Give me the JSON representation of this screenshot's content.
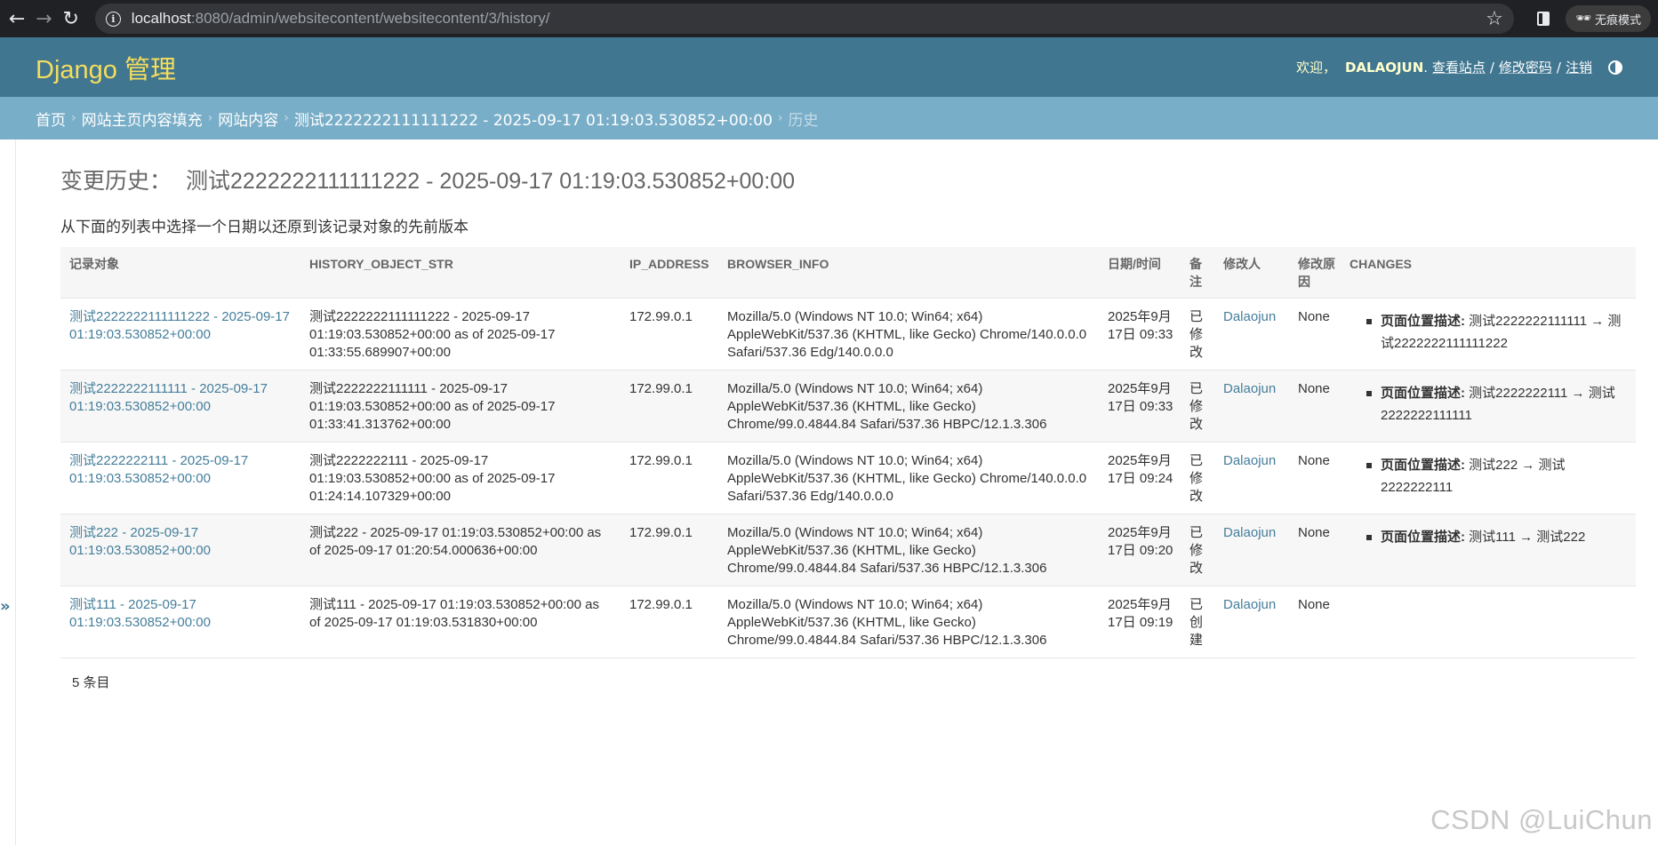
{
  "browser": {
    "url_host": "localhost",
    "url_rest": ":8080/admin/websitecontent/websitecontent/3/history/",
    "incognito_label": "无痕模式"
  },
  "header": {
    "brand": "Django 管理",
    "welcome": "欢迎，",
    "username": "DALAOJUN",
    "view_site": "查看站点",
    "change_password": "修改密码",
    "logout": "注销",
    "separator": "/"
  },
  "breadcrumbs": {
    "home": "首页",
    "app": "网站主页内容填充",
    "model": "网站内容",
    "object": "测试2222222111111222 - 2025-09-17 01:19:03.530852+00:00",
    "current": "历史"
  },
  "page": {
    "title_prefix": "变更历史：",
    "title_object": "测试2222222111111222 - 2025-09-17 01:19:03.530852+00:00",
    "instructions": "从下面的列表中选择一个日期以还原到该记录对象的先前版本",
    "paginator": "5 条目"
  },
  "table": {
    "headers": {
      "object": "记录对象",
      "history_str": "HISTORY_OBJECT_STR",
      "ip": "IP_ADDRESS",
      "browser": "BROWSER_INFO",
      "date": "日期/时间",
      "note": "备注",
      "user": "修改人",
      "reason": "修改原因",
      "changes": "CHANGES"
    },
    "rows": [
      {
        "object": "测试2222222111111222 - 2025-09-17 01:19:03.530852+00:00",
        "history_str": "测试2222222111111222 - 2025-09-17 01:19:03.530852+00:00 as of 2025-09-17 01:33:55.689907+00:00",
        "ip": "172.99.0.1",
        "browser": "Mozilla/5.0 (Windows NT 10.0; Win64; x64) AppleWebKit/537.36 (KHTML, like Gecko) Chrome/140.0.0.0 Safari/537.36 Edg/140.0.0.0",
        "date": "2025年9月17日 09:33",
        "note": "已修改",
        "user": "Dalaojun",
        "reason": "None",
        "change_field": "页面位置描述:",
        "change_text": " 测试2222222111111 → 测试2222222111111222"
      },
      {
        "object": "测试2222222111111 - 2025-09-17 01:19:03.530852+00:00",
        "history_str": "测试2222222111111 - 2025-09-17 01:19:03.530852+00:00 as of 2025-09-17 01:33:41.313762+00:00",
        "ip": "172.99.0.1",
        "browser": "Mozilla/5.0 (Windows NT 10.0; Win64; x64) AppleWebKit/537.36 (KHTML, like Gecko) Chrome/99.0.4844.84 Safari/537.36 HBPC/12.1.3.306",
        "date": "2025年9月17日 09:33",
        "note": "已修改",
        "user": "Dalaojun",
        "reason": "None",
        "change_field": "页面位置描述:",
        "change_text": " 测试2222222111 → 测试2222222111111"
      },
      {
        "object": "测试2222222111 - 2025-09-17 01:19:03.530852+00:00",
        "history_str": "测试2222222111 - 2025-09-17 01:19:03.530852+00:00 as of 2025-09-17 01:24:14.107329+00:00",
        "ip": "172.99.0.1",
        "browser": "Mozilla/5.0 (Windows NT 10.0; Win64; x64) AppleWebKit/537.36 (KHTML, like Gecko) Chrome/140.0.0.0 Safari/537.36 Edg/140.0.0.0",
        "date": "2025年9月17日 09:24",
        "note": "已修改",
        "user": "Dalaojun",
        "reason": "None",
        "change_field": "页面位置描述:",
        "change_text": " 测试222 → 测试2222222111"
      },
      {
        "object": "测试222 - 2025-09-17 01:19:03.530852+00:00",
        "history_str": "测试222 - 2025-09-17 01:19:03.530852+00:00 as of 2025-09-17 01:20:54.000636+00:00",
        "ip": "172.99.0.1",
        "browser": "Mozilla/5.0 (Windows NT 10.0; Win64; x64) AppleWebKit/537.36 (KHTML, like Gecko) Chrome/99.0.4844.84 Safari/537.36 HBPC/12.1.3.306",
        "date": "2025年9月17日 09:20",
        "note": "已修改",
        "user": "Dalaojun",
        "reason": "None",
        "change_field": "页面位置描述:",
        "change_text": " 测试111 → 测试222"
      },
      {
        "object": "测试111 - 2025-09-17 01:19:03.530852+00:00",
        "history_str": "测试111 - 2025-09-17 01:19:03.530852+00:00 as of 2025-09-17 01:19:03.531830+00:00",
        "ip": "172.99.0.1",
        "browser": "Mozilla/5.0 (Windows NT 10.0; Win64; x64) AppleWebKit/537.36 (KHTML, like Gecko) Chrome/99.0.4844.84 Safari/537.36 HBPC/12.1.3.306",
        "date": "2025年9月17日 09:19",
        "note": "已创建",
        "user": "Dalaojun",
        "reason": "None",
        "change_field": "",
        "change_text": ""
      }
    ]
  },
  "watermark": "CSDN @LuiChun",
  "icons": {
    "back": "arrow-left-icon",
    "forward": "arrow-right-icon",
    "reload": "reload-icon",
    "site_info": "info-icon",
    "bookmark": "star-icon",
    "side_panel": "side-panel-icon",
    "incognito": "incognito-icon",
    "theme": "theme-toggle-icon",
    "sidebar": "sidebar-toggle-icon"
  },
  "colors": {
    "header_bg": "#417690",
    "brand": "#f5dd5d",
    "breadcrumb_bg": "#79aec8",
    "link": "#447e9b"
  }
}
